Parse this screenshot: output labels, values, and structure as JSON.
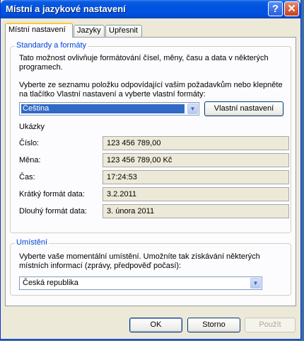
{
  "window": {
    "title": "Místní a jazykové nastavení",
    "help_glyph": "?",
    "close_glyph": "✕"
  },
  "tabs": [
    {
      "label": "Místní nastavení",
      "active": true
    },
    {
      "label": "Jazyky",
      "active": false
    },
    {
      "label": "Upřesnit",
      "active": false
    }
  ],
  "standards": {
    "legend": "Standardy a formáty",
    "desc": "Tato možnost ovlivňuje formátování čísel, měny, času a data v některých programech.",
    "instr": "Vyberte ze seznamu položku odpovídající vašim požadavkům nebo klepněte na tlačítko Vlastní nastavení a vyberte vlastní formáty:",
    "selected_format": "Čeština",
    "customize_button": "Vlastní nastavení",
    "samples_label": "Ukázky",
    "samples": [
      {
        "label": "Číslo:",
        "value": "123 456 789,00"
      },
      {
        "label": "Měna:",
        "value": "123 456 789,00 Kč"
      },
      {
        "label": "Čas:",
        "value": "17:24:53"
      },
      {
        "label": "Krátký formát data:",
        "value": "3.2.2011"
      },
      {
        "label": "Dlouhý formát data:",
        "value": "3. února 2011"
      }
    ]
  },
  "location": {
    "legend": "Umístění",
    "desc": "Vyberte vaše momentální umístění. Umožníte tak získávání některých místních informací (zprávy, předpověď počasí):",
    "selected_location": "Česká republika"
  },
  "footer": {
    "ok": "OK",
    "cancel": "Storno",
    "apply": "Použít"
  },
  "icons": {
    "dropdown": "chevron-down-icon"
  },
  "colors": {
    "title_bar": "#0053e1",
    "legend_text": "#0046d5",
    "selection": "#316ac5"
  }
}
